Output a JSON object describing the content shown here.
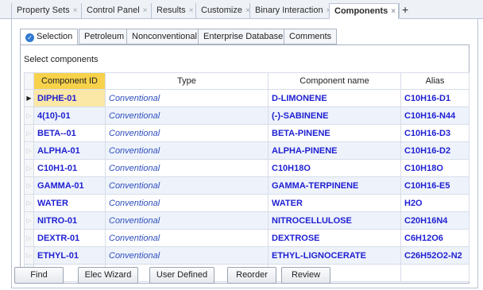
{
  "doc_tabs": [
    {
      "label": "Property Sets",
      "close": "×"
    },
    {
      "label": "Control Panel",
      "close": "×"
    },
    {
      "label": "Results",
      "close": "×"
    },
    {
      "label": "Customize",
      "close": "×"
    },
    {
      "label": "Binary Interaction",
      "close": "×"
    },
    {
      "label": "Components",
      "close": "×"
    }
  ],
  "add_tab_label": "+",
  "sub_tabs": [
    "Selection",
    "Petroleum",
    "Nonconventional",
    "Enterprise Database",
    "Comments"
  ],
  "section_label": "Select components",
  "grid": {
    "headers": [
      "Component ID",
      "Type",
      "Component name",
      "Alias"
    ],
    "rows": [
      {
        "id": "DIPHE-01",
        "type": "Conventional",
        "name": "D-LIMONENE",
        "alias": "C10H16-D1"
      },
      {
        "id": "4(10)-01",
        "type": "Conventional",
        "name": "(-)-SABINENE",
        "alias": "C10H16-N44"
      },
      {
        "id": "BETA--01",
        "type": "Conventional",
        "name": "BETA-PINENE",
        "alias": "C10H16-D3"
      },
      {
        "id": "ALPHA-01",
        "type": "Conventional",
        "name": "ALPHA-PINENE",
        "alias": "C10H16-D2"
      },
      {
        "id": "C10H1-01",
        "type": "Conventional",
        "name": "C10H18O",
        "alias": "C10H18O"
      },
      {
        "id": "GAMMA-01",
        "type": "Conventional",
        "name": "GAMMA-TERPINENE",
        "alias": "C10H16-E5"
      },
      {
        "id": "WATER",
        "type": "Conventional",
        "name": "WATER",
        "alias": "H2O"
      },
      {
        "id": "NITRO-01",
        "type": "Conventional",
        "name": "NITROCELLULOSE",
        "alias": "C20H16N4"
      },
      {
        "id": "DEXTR-01",
        "type": "Conventional",
        "name": "DEXTROSE",
        "alias": "C6H12O6"
      },
      {
        "id": "ETHYL-01",
        "type": "Conventional",
        "name": "ETHYL-LIGNOCERATE",
        "alias": "C26H52O2-N2"
      }
    ]
  },
  "buttons": [
    "Find",
    "Elec Wizard",
    "User Defined",
    "Reorder",
    "Review"
  ],
  "colors": {
    "accent": "#f7d24a",
    "link": "#1e1ed2",
    "type_text": "#2f4fbf",
    "alt_row": "#eef3fb"
  }
}
